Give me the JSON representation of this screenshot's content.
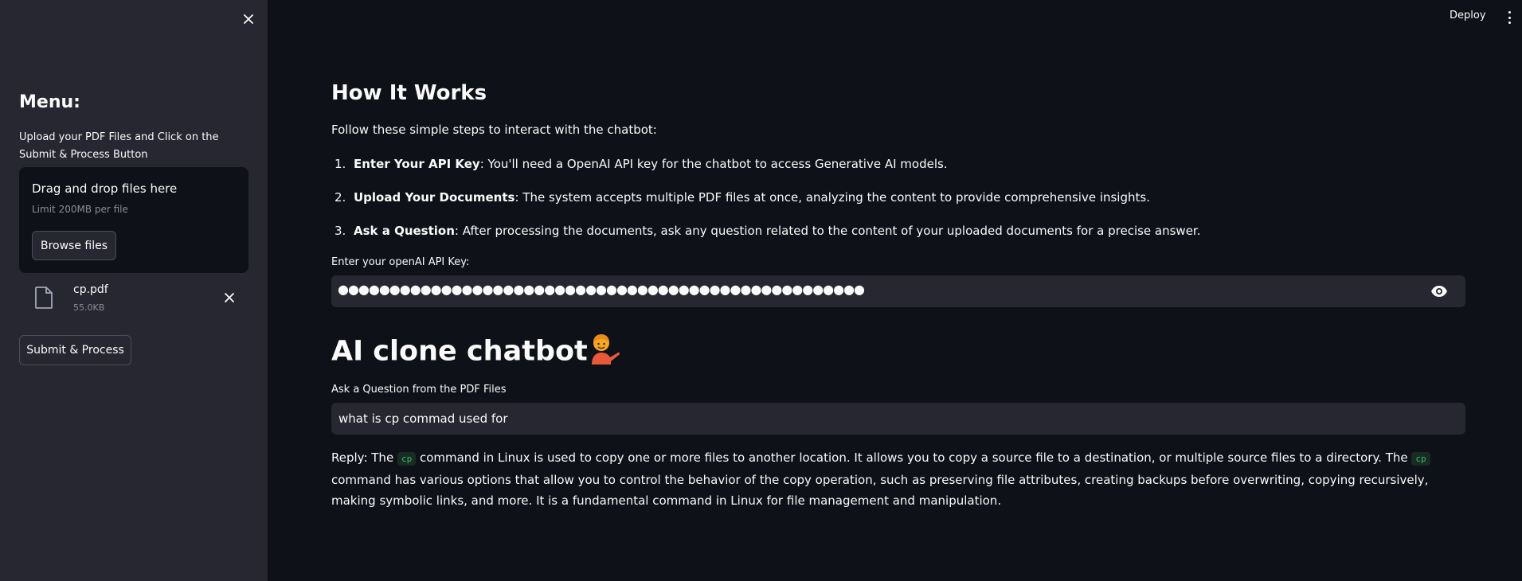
{
  "sidebar": {
    "menu_title": "Menu:",
    "upload_label": "Upload your PDF Files and Click on the Submit & Process Button",
    "dropzone": {
      "title": "Drag and drop files here",
      "limit": "Limit 200MB per file",
      "browse_label": "Browse files"
    },
    "file": {
      "name": "cp.pdf",
      "size": "55.0KB"
    },
    "submit_label": "Submit & Process"
  },
  "header": {
    "deploy_label": "Deploy"
  },
  "main": {
    "how_title": "How It Works",
    "intro": "Follow these simple steps to interact with the chatbot:",
    "steps": [
      {
        "num": "1.",
        "bold": "Enter Your API Key",
        "text": ": You'll need a OpenAI API key for the chatbot to access Generative AI models."
      },
      {
        "num": "2.",
        "bold": "Upload Your Documents",
        "text": ": The system accepts multiple PDF files at once, analyzing the content to provide comprehensive insights."
      },
      {
        "num": "3.",
        "bold": "Ask a Question",
        "text": ": After processing the documents, ask any question related to the content of your uploaded documents for a precise answer."
      }
    ],
    "api_label": "Enter your openAI API Key:",
    "api_masked": "●●●●●●●●●●●●●●●●●●●●●●●●●●●●●●●●●●●●●●●●●●●●●●●●●●●",
    "chat_title": "AI clone chatbot",
    "question_label": "Ask a Question from the PDF Files",
    "question_value": "what is cp commad used for",
    "reply": {
      "prefix": "Reply: The ",
      "code1": "cp",
      "part2": " command in Linux is used to copy one or more files to another location. It allows you to copy a source file to a destination, or multiple source files to a directory. The ",
      "code2": "cp",
      "part3": " command has various options that allow you to control the behavior of the copy operation, such as preserving file attributes, creating backups before overwriting, copying recursively, making symbolic links, and more. It is a fundamental command in Linux for file management and manipulation."
    }
  },
  "icons": {
    "close": "close-icon",
    "file": "file-icon",
    "eye": "eye-icon",
    "kebab": "more-vert-icon"
  }
}
